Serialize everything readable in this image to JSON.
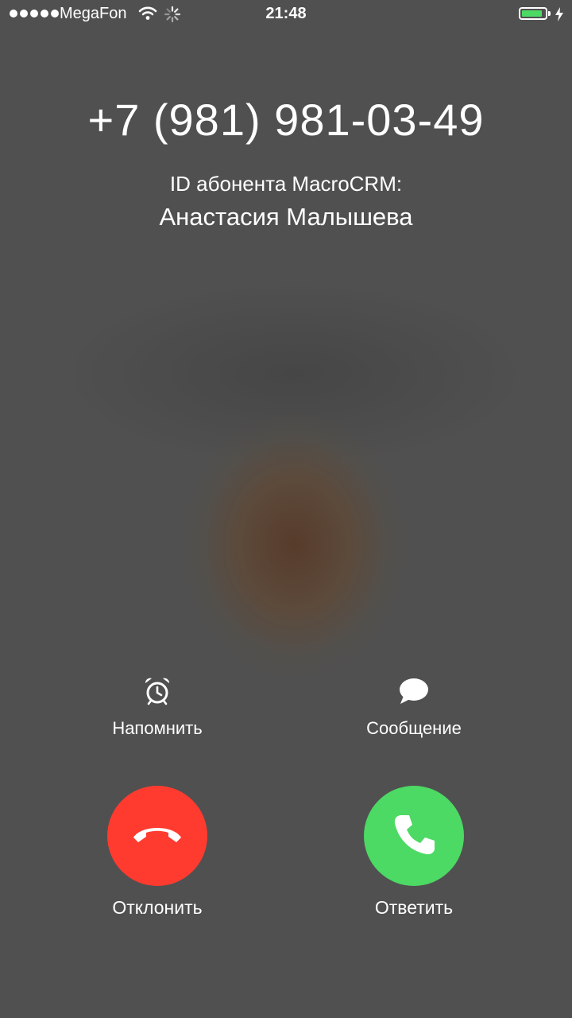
{
  "status_bar": {
    "carrier": "MegaFon",
    "time": "21:48",
    "signal_bars": 5,
    "battery_level": 0.9,
    "battery_color": "#4cd964",
    "icons": [
      "signal-dots-icon",
      "wifi-icon",
      "activity-spinner-icon",
      "battery-icon",
      "charging-bolt-icon"
    ]
  },
  "caller": {
    "phone_number": "+7 (981) 981-03-49",
    "id_label": "ID абонента MacroCRM:",
    "name": "Анастасия Малышева"
  },
  "actions": {
    "remind_label": "Напомнить",
    "remind_icon": "alarm-clock-icon",
    "message_label": "Сообщение",
    "message_icon": "speech-bubble-icon"
  },
  "call_controls": {
    "decline_label": "Отклонить",
    "decline_color": "#ff3b30",
    "decline_icon": "hang-up-icon",
    "accept_label": "Ответить",
    "accept_color": "#4cd964",
    "accept_icon": "phone-handset-icon"
  },
  "colors": {
    "background": "#505050",
    "text": "#ffffff"
  }
}
